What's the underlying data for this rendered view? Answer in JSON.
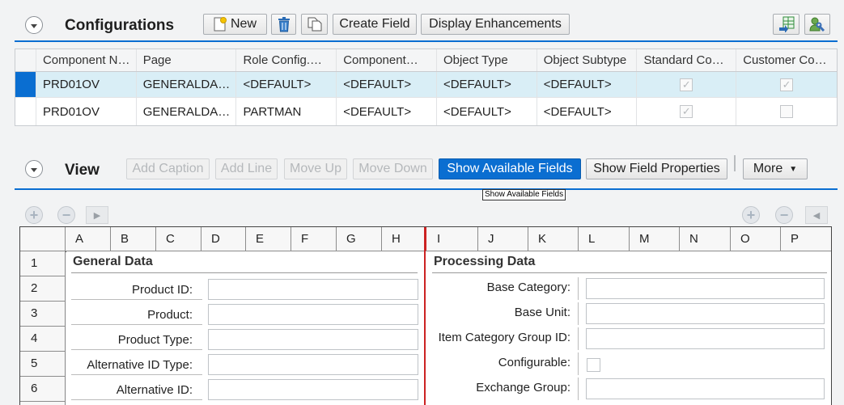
{
  "configurations": {
    "title": "Configurations",
    "toolbar": {
      "new_label": "New",
      "create_field_label": "Create Field",
      "display_enhancements_label": "Display Enhancements"
    },
    "columns": [
      "Component N…",
      "Page",
      "Role Config.…",
      "Component…",
      "Object Type",
      "Object Subtype",
      "Standard Co…",
      "Customer Co…"
    ],
    "rows": [
      {
        "component": "PRD01OV",
        "page": "GENERALDA…",
        "role": "<DEFAULT>",
        "comp": "<DEFAULT>",
        "object_type": "<DEFAULT>",
        "object_subtype": "<DEFAULT>",
        "standard": true,
        "customer": true
      },
      {
        "component": "PRD01OV",
        "page": "GENERALDA…",
        "role": "PARTMAN",
        "comp": "<DEFAULT>",
        "object_type": "<DEFAULT>",
        "object_subtype": "<DEFAULT>",
        "standard": true,
        "customer": false
      }
    ]
  },
  "view": {
    "title": "View",
    "toolbar": {
      "add_caption": "Add Caption",
      "add_line": "Add Line",
      "move_up": "Move Up",
      "move_down": "Move Down",
      "show_available_fields": "Show Available Fields",
      "show_field_properties": "Show Field Properties",
      "more": "More"
    },
    "tooltip": "Show Available Fields",
    "grid_columns": [
      "A",
      "B",
      "C",
      "D",
      "E",
      "F",
      "G",
      "H",
      "I",
      "J",
      "K",
      "L",
      "M",
      "N",
      "O",
      "P"
    ],
    "rows": [
      "1",
      "2",
      "3",
      "4",
      "5",
      "6"
    ],
    "left_section": "General Data",
    "right_section": "Processing Data",
    "left_labels": [
      "Product ID:",
      "Product:",
      "Product Type:",
      "Alternative ID Type:",
      "Alternative ID:"
    ],
    "right_labels": [
      "Base Category:",
      "Base Unit:",
      "Item Category Group ID:",
      "Configurable:",
      "Exchange Group:"
    ]
  },
  "colors": {
    "accent": "#0a6ed1",
    "divider": "#cc2222",
    "selected_row": "#d9eef6"
  }
}
